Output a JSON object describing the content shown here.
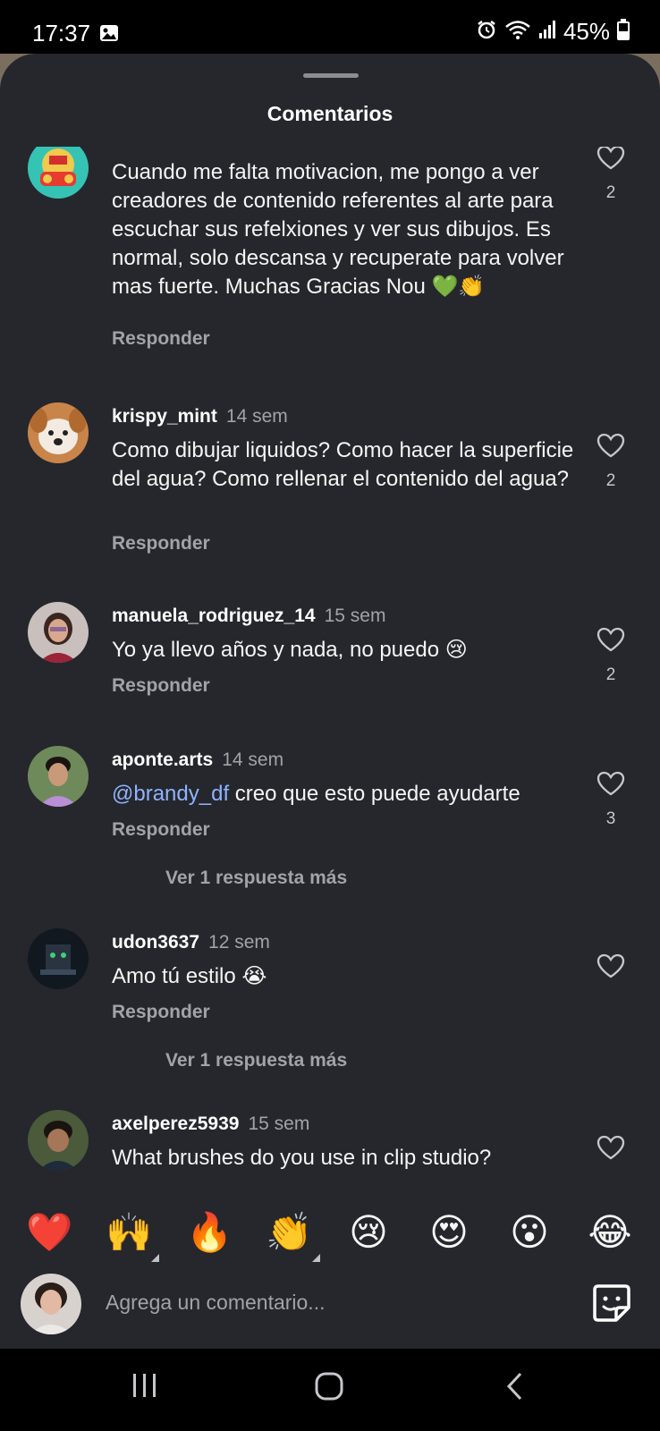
{
  "status_bar": {
    "time": "17:37",
    "battery": "45%"
  },
  "sheet": {
    "title": "Comentarios"
  },
  "comments": [
    {
      "username": "",
      "timestamp": "",
      "text": "Cuando me falta motivacion, me pongo a ver creadores de contenido referentes al arte para escuchar sus refelxiones y ver sus dibujos. Es normal, solo descansa y recuperate para volver mas fuerte. Muchas Gracias Nou 💚👏",
      "reply": "Responder",
      "likes": "2"
    },
    {
      "username": "krispy_mint",
      "timestamp": "14 sem",
      "text": "Como dibujar liquidos? Como hacer la superficie del agua? Como rellenar el contenido del agua?",
      "reply": "Responder",
      "likes": "2"
    },
    {
      "username": "manuela_rodriguez_14",
      "timestamp": "15 sem",
      "text": "Yo ya llevo años y nada, no puedo 😢",
      "reply": "Responder",
      "likes": "2"
    },
    {
      "username": "aponte.arts",
      "timestamp": "14 sem",
      "mention": "@brandy_df",
      "text": " creo que esto puede ayudarte",
      "reply": "Responder",
      "likes": "3",
      "view_more": "Ver 1 respuesta más"
    },
    {
      "username": "udon3637",
      "timestamp": "12 sem",
      "text": "Amo tú estilo 😭",
      "reply": "Responder",
      "likes": "",
      "view_more": "Ver 1 respuesta más"
    },
    {
      "username": "axelperez5939",
      "timestamp": "15 sem",
      "text": "What brushes do you use in clip studio?",
      "likes": ""
    }
  ],
  "reactions": [
    "❤️",
    "🙌",
    "🔥",
    "👏",
    "😢",
    "😍",
    "😮",
    "😂"
  ],
  "composer": {
    "placeholder": "Agrega un comentario..."
  },
  "icons": {
    "like": "heart-outline-icon",
    "sticker": "sticker-icon",
    "nav": [
      "recent-apps-icon",
      "home-icon",
      "back-icon"
    ]
  },
  "colors": {
    "sheet_bg": "#25272c",
    "mention": "#8fb3ff",
    "secondary_text": "#a0a3a8"
  }
}
